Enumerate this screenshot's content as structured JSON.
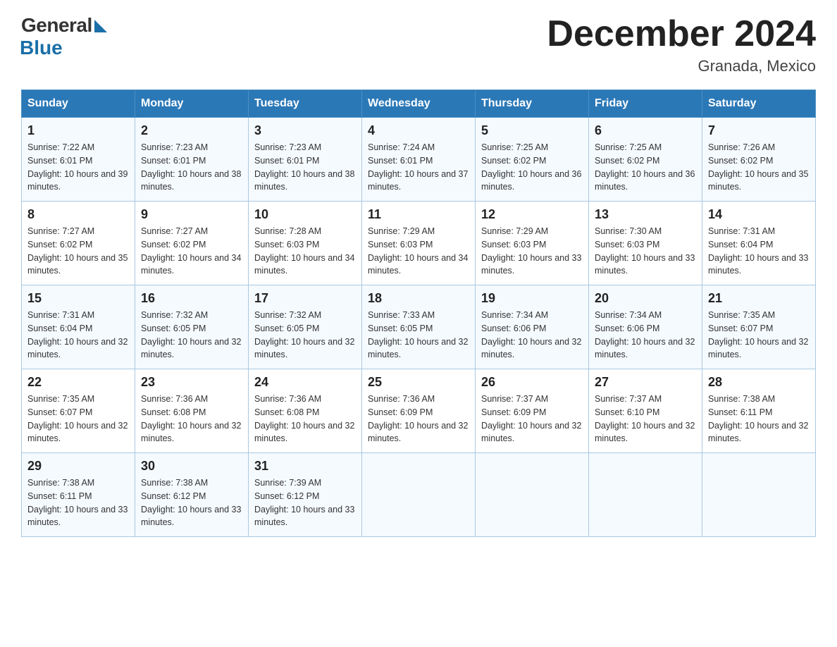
{
  "header": {
    "logo_general": "General",
    "logo_blue": "Blue",
    "month_title": "December 2024",
    "location": "Granada, Mexico"
  },
  "days_of_week": [
    "Sunday",
    "Monday",
    "Tuesday",
    "Wednesday",
    "Thursday",
    "Friday",
    "Saturday"
  ],
  "weeks": [
    [
      {
        "day": "1",
        "sunrise": "7:22 AM",
        "sunset": "6:01 PM",
        "daylight": "10 hours and 39 minutes."
      },
      {
        "day": "2",
        "sunrise": "7:23 AM",
        "sunset": "6:01 PM",
        "daylight": "10 hours and 38 minutes."
      },
      {
        "day": "3",
        "sunrise": "7:23 AM",
        "sunset": "6:01 PM",
        "daylight": "10 hours and 38 minutes."
      },
      {
        "day": "4",
        "sunrise": "7:24 AM",
        "sunset": "6:01 PM",
        "daylight": "10 hours and 37 minutes."
      },
      {
        "day": "5",
        "sunrise": "7:25 AM",
        "sunset": "6:02 PM",
        "daylight": "10 hours and 36 minutes."
      },
      {
        "day": "6",
        "sunrise": "7:25 AM",
        "sunset": "6:02 PM",
        "daylight": "10 hours and 36 minutes."
      },
      {
        "day": "7",
        "sunrise": "7:26 AM",
        "sunset": "6:02 PM",
        "daylight": "10 hours and 35 minutes."
      }
    ],
    [
      {
        "day": "8",
        "sunrise": "7:27 AM",
        "sunset": "6:02 PM",
        "daylight": "10 hours and 35 minutes."
      },
      {
        "day": "9",
        "sunrise": "7:27 AM",
        "sunset": "6:02 PM",
        "daylight": "10 hours and 34 minutes."
      },
      {
        "day": "10",
        "sunrise": "7:28 AM",
        "sunset": "6:03 PM",
        "daylight": "10 hours and 34 minutes."
      },
      {
        "day": "11",
        "sunrise": "7:29 AM",
        "sunset": "6:03 PM",
        "daylight": "10 hours and 34 minutes."
      },
      {
        "day": "12",
        "sunrise": "7:29 AM",
        "sunset": "6:03 PM",
        "daylight": "10 hours and 33 minutes."
      },
      {
        "day": "13",
        "sunrise": "7:30 AM",
        "sunset": "6:03 PM",
        "daylight": "10 hours and 33 minutes."
      },
      {
        "day": "14",
        "sunrise": "7:31 AM",
        "sunset": "6:04 PM",
        "daylight": "10 hours and 33 minutes."
      }
    ],
    [
      {
        "day": "15",
        "sunrise": "7:31 AM",
        "sunset": "6:04 PM",
        "daylight": "10 hours and 32 minutes."
      },
      {
        "day": "16",
        "sunrise": "7:32 AM",
        "sunset": "6:05 PM",
        "daylight": "10 hours and 32 minutes."
      },
      {
        "day": "17",
        "sunrise": "7:32 AM",
        "sunset": "6:05 PM",
        "daylight": "10 hours and 32 minutes."
      },
      {
        "day": "18",
        "sunrise": "7:33 AM",
        "sunset": "6:05 PM",
        "daylight": "10 hours and 32 minutes."
      },
      {
        "day": "19",
        "sunrise": "7:34 AM",
        "sunset": "6:06 PM",
        "daylight": "10 hours and 32 minutes."
      },
      {
        "day": "20",
        "sunrise": "7:34 AM",
        "sunset": "6:06 PM",
        "daylight": "10 hours and 32 minutes."
      },
      {
        "day": "21",
        "sunrise": "7:35 AM",
        "sunset": "6:07 PM",
        "daylight": "10 hours and 32 minutes."
      }
    ],
    [
      {
        "day": "22",
        "sunrise": "7:35 AM",
        "sunset": "6:07 PM",
        "daylight": "10 hours and 32 minutes."
      },
      {
        "day": "23",
        "sunrise": "7:36 AM",
        "sunset": "6:08 PM",
        "daylight": "10 hours and 32 minutes."
      },
      {
        "day": "24",
        "sunrise": "7:36 AM",
        "sunset": "6:08 PM",
        "daylight": "10 hours and 32 minutes."
      },
      {
        "day": "25",
        "sunrise": "7:36 AM",
        "sunset": "6:09 PM",
        "daylight": "10 hours and 32 minutes."
      },
      {
        "day": "26",
        "sunrise": "7:37 AM",
        "sunset": "6:09 PM",
        "daylight": "10 hours and 32 minutes."
      },
      {
        "day": "27",
        "sunrise": "7:37 AM",
        "sunset": "6:10 PM",
        "daylight": "10 hours and 32 minutes."
      },
      {
        "day": "28",
        "sunrise": "7:38 AM",
        "sunset": "6:11 PM",
        "daylight": "10 hours and 32 minutes."
      }
    ],
    [
      {
        "day": "29",
        "sunrise": "7:38 AM",
        "sunset": "6:11 PM",
        "daylight": "10 hours and 33 minutes."
      },
      {
        "day": "30",
        "sunrise": "7:38 AM",
        "sunset": "6:12 PM",
        "daylight": "10 hours and 33 minutes."
      },
      {
        "day": "31",
        "sunrise": "7:39 AM",
        "sunset": "6:12 PM",
        "daylight": "10 hours and 33 minutes."
      },
      null,
      null,
      null,
      null
    ]
  ]
}
